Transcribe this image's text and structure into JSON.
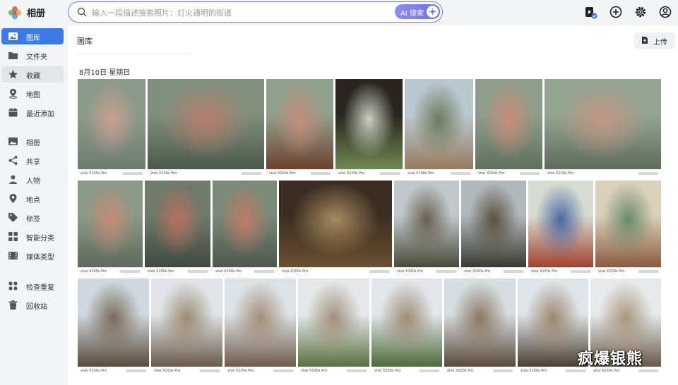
{
  "app": {
    "name": "相册",
    "brand_colors": [
      "#e84c3d",
      "#f5a623",
      "#4a90e2",
      "#50b848",
      "#9b59b6"
    ],
    "accent": "#3d7ae6"
  },
  "search": {
    "placeholder": "输入一段描述搜索照片：灯火通明的街道",
    "ai_label": "AI 搜索"
  },
  "top_icons": [
    "photo-sync-icon",
    "add-circle-icon",
    "settings-icon",
    "account-icon"
  ],
  "sidebar": {
    "items": [
      {
        "label": "图库",
        "icon": "gallery-icon",
        "active": true
      },
      {
        "label": "文件夹",
        "icon": "folder-icon"
      },
      {
        "label": "收藏",
        "icon": "star-icon",
        "hover": true
      },
      {
        "label": "地图",
        "icon": "map-pin-icon"
      },
      {
        "label": "最近添加",
        "icon": "calendar-icon"
      },
      {
        "label": "相册",
        "icon": "album-icon"
      },
      {
        "label": "共享",
        "icon": "share-icon"
      },
      {
        "label": "人物",
        "icon": "person-icon"
      },
      {
        "label": "地点",
        "icon": "location-icon"
      },
      {
        "label": "标签",
        "icon": "tag-icon"
      },
      {
        "label": "智能分类",
        "icon": "smart-category-icon"
      },
      {
        "label": "媒体类型",
        "icon": "media-type-icon"
      },
      {
        "label": "检查重复",
        "icon": "duplicate-icon"
      },
      {
        "label": "回收站",
        "icon": "trash-icon"
      }
    ]
  },
  "main": {
    "title": "图库",
    "upload_label": "上传",
    "date_group": "8月10日 星期日",
    "camera_label": "vivo X100s Pro",
    "photos": [
      {
        "subject": "fresco-bodhisattva",
        "colors": [
          "#8a9a8a",
          "#c8a090",
          "#6e7d70"
        ]
      },
      {
        "subject": "fresco-wall-wide",
        "colors": [
          "#7f8f7c",
          "#b57d6d",
          "#4c5a4c"
        ]
      },
      {
        "subject": "fresco-with-visitor",
        "colors": [
          "#8fa08a",
          "#c48b7a",
          "#704030"
        ]
      },
      {
        "subject": "temple-doorway",
        "colors": [
          "#2a2520",
          "#c8d0c0",
          "#6d8a50"
        ]
      },
      {
        "subject": "temple-pavilion",
        "colors": [
          "#b8c8d0",
          "#6f7a5a",
          "#9a7a60"
        ]
      },
      {
        "subject": "fresco-figures",
        "colors": [
          "#8e9d8a",
          "#c98b78",
          "#62705e"
        ]
      },
      {
        "subject": "fresco-goddess",
        "colors": [
          "#93a491",
          "#c39584",
          "#5f6c5c"
        ]
      },
      {
        "subject": "fresco-guanyin-closeup",
        "colors": [
          "#8a9a88",
          "#c48a76",
          "#5e6a5c"
        ]
      },
      {
        "subject": "fresco-deity",
        "colors": [
          "#6e7a6a",
          "#b87060",
          "#3f4a40"
        ]
      },
      {
        "subject": "fresco-guardian",
        "colors": [
          "#7a8a78",
          "#c07a66",
          "#4d584c"
        ]
      },
      {
        "subject": "buddha-statues-hall",
        "colors": [
          "#3a2e22",
          "#a88a60",
          "#6a5030"
        ]
      },
      {
        "subject": "temple-tree-courtyard",
        "colors": [
          "#c0c8cc",
          "#6a6050",
          "#4a4a3a"
        ]
      },
      {
        "subject": "courtyard-old-tree",
        "colors": [
          "#b0b8bc",
          "#5a5040",
          "#3a3a30"
        ]
      },
      {
        "subject": "guardian-statue-sign",
        "colors": [
          "#d8dcd0",
          "#4a6aa0",
          "#a04030"
        ]
      },
      {
        "subject": "site-map-board",
        "colors": [
          "#d8d0b8",
          "#6a8a6a",
          "#8a5a40"
        ]
      },
      {
        "subject": "hillside-gate-flag",
        "colors": [
          "#cfd8e0",
          "#7a6a58",
          "#5a4a3a"
        ]
      },
      {
        "subject": "pagoda-stairs-1",
        "colors": [
          "#e0e4e8",
          "#9a8a72",
          "#6a5a48"
        ]
      },
      {
        "subject": "pagoda-stairs-2",
        "colors": [
          "#dde2e6",
          "#a08e76",
          "#6e5c4a"
        ]
      },
      {
        "subject": "pagoda-trees",
        "colors": [
          "#e4e8ea",
          "#a0907a",
          "#5a7040"
        ]
      },
      {
        "subject": "pagoda-tree-right",
        "colors": [
          "#e2e6ea",
          "#9c8c74",
          "#4e6a3a"
        ]
      },
      {
        "subject": "pagoda-base-visitor",
        "colors": [
          "#d6dce0",
          "#8a7860",
          "#5a4a38"
        ]
      },
      {
        "subject": "pagoda-tall",
        "colors": [
          "#dfe4e8",
          "#9a8870",
          "#4a3e30"
        ]
      },
      {
        "subject": "pagoda-side",
        "colors": [
          "#e6eaec",
          "#a8967c",
          "#6a5844"
        ]
      }
    ]
  },
  "watermark": "疯爆银熊"
}
